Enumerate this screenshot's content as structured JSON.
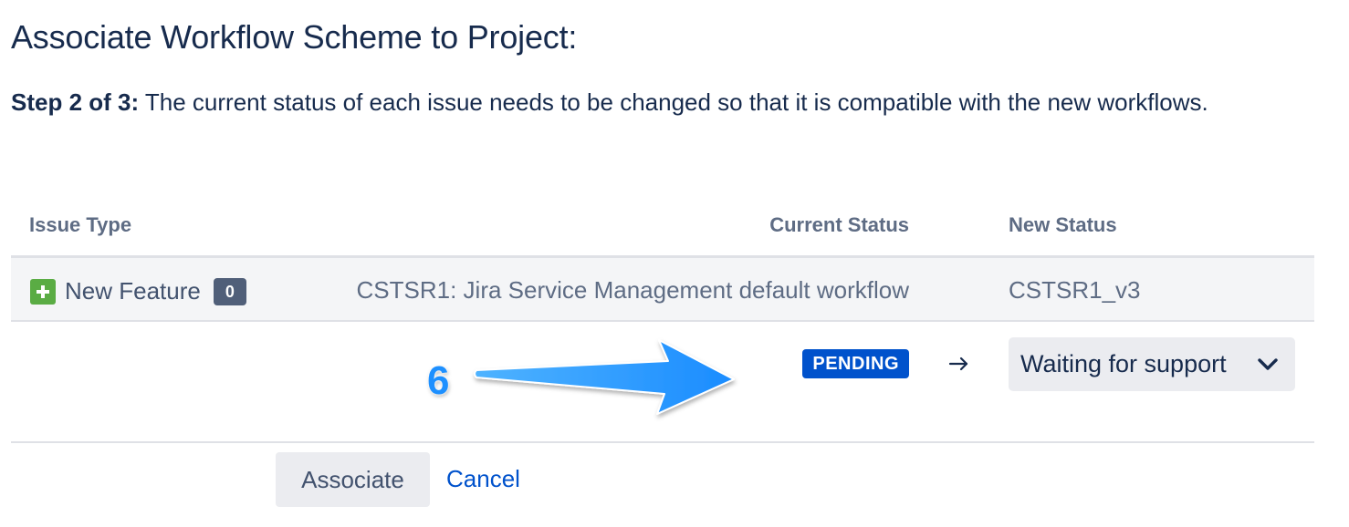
{
  "page": {
    "title": "Associate Workflow Scheme to Project:",
    "step_label": "Step 2 of 3:",
    "step_text": " The current status of each issue needs to be changed so that it is compatible with the new workflows."
  },
  "table": {
    "columns": {
      "issue_type": "Issue Type",
      "current_status": "Current Status",
      "new_status": "New Status"
    },
    "row": {
      "issue_type": "New Feature",
      "issue_icon": "new-feature-plus-icon",
      "issue_count": "0",
      "current_workflow": "CSTSR1: Jira Service Management default workflow",
      "new_workflow": "CSTSR1_v3"
    },
    "mapping": {
      "current_status": "PENDING",
      "arrow_icon": "right-arrow-icon",
      "new_status_selected": "Waiting for support",
      "dropdown_icon": "chevron-down-icon"
    }
  },
  "annotation": {
    "number": "6"
  },
  "actions": {
    "associate_label": "Associate",
    "cancel_label": "Cancel"
  },
  "colors": {
    "primary_text": "#172b4d",
    "muted_text": "#5e6c84",
    "status_blue": "#0052cc",
    "link_blue": "#0052cc",
    "new_feature_green": "#5aac44",
    "annotation_blue": "#1e90ff",
    "button_bg": "#ebecf0"
  }
}
